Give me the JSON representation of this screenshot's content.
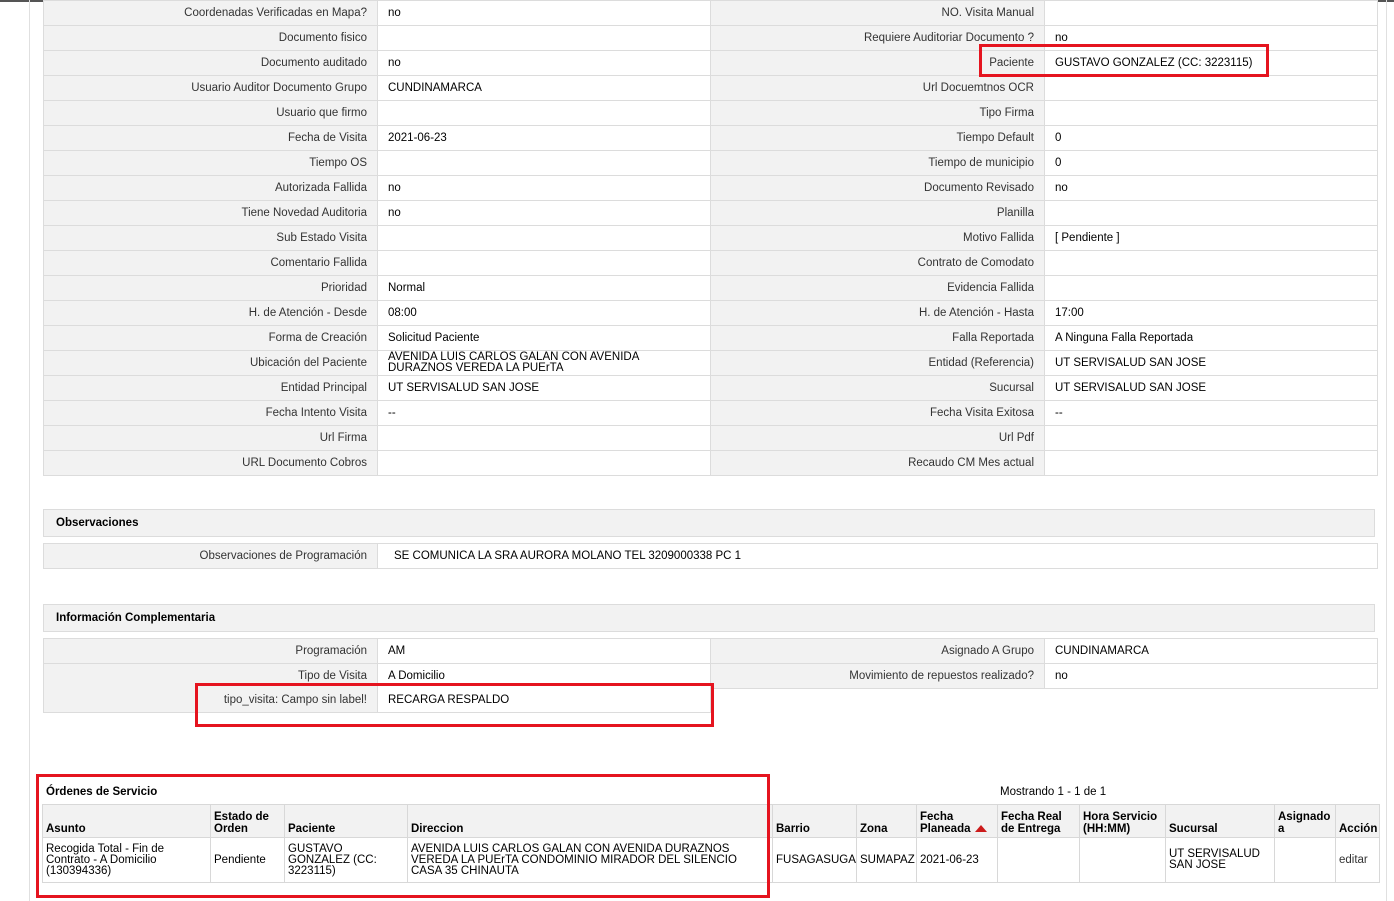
{
  "details": [
    {
      "l1": "Coordenadas Verificadas en Mapa?",
      "v1": "no",
      "l2": "NO. Visita Manual",
      "v2": ""
    },
    {
      "l1": "Documento fisico",
      "v1": "",
      "l2": "Requiere Auditoriar Documento ?",
      "v2": "no"
    },
    {
      "l1": "Documento auditado",
      "v1": "no",
      "l2": "Paciente",
      "v2": "GUSTAVO GONZALEZ (CC: 3223115)"
    },
    {
      "l1": "Usuario Auditor Documento Grupo",
      "v1": "CUNDINAMARCA",
      "l2": "Url Docuemtnos OCR",
      "v2": ""
    },
    {
      "l1": "Usuario que firmo",
      "v1": "",
      "l2": "Tipo Firma",
      "v2": ""
    },
    {
      "l1": "Fecha de Visita",
      "v1": "2021-06-23",
      "l2": "Tiempo Default",
      "v2": "0"
    },
    {
      "l1": "Tiempo OS",
      "v1": "",
      "l2": "Tiempo de municipio",
      "v2": "0"
    },
    {
      "l1": "Autorizada Fallida",
      "v1": "no",
      "l2": "Documento Revisado",
      "v2": "no"
    },
    {
      "l1": "Tiene Novedad Auditoria",
      "v1": "no",
      "l2": "Planilla",
      "v2": ""
    },
    {
      "l1": "Sub Estado Visita",
      "v1": "",
      "l2": "Motivo Fallida",
      "v2": "[ Pendiente ]"
    },
    {
      "l1": "Comentario Fallida",
      "v1": "",
      "l2": "Contrato de Comodato",
      "v2": ""
    },
    {
      "l1": "Prioridad",
      "v1": "Normal",
      "l2": "Evidencia Fallida",
      "v2": ""
    },
    {
      "l1": "H. de Atención - Desde",
      "v1": "08:00",
      "l2": "H. de Atención - Hasta",
      "v2": "17:00"
    },
    {
      "l1": "Forma de Creación",
      "v1": "Solicitud Paciente",
      "l2": "Falla Reportada",
      "v2": "A Ninguna Falla Reportada"
    },
    {
      "l1": "Ubicación del Paciente",
      "v1": "AVENIDA LUIS CARLOS GALAN CON AVENIDA DURAZNOS VEREDA LA PUErTA",
      "l2": "Entidad (Referencia)",
      "v2": "UT SERVISALUD SAN JOSE"
    },
    {
      "l1": "Entidad Principal",
      "v1": "UT SERVISALUD SAN JOSE",
      "l2": "Sucursal",
      "v2": "UT SERVISALUD SAN JOSE"
    },
    {
      "l1": "Fecha Intento Visita",
      "v1": "--",
      "l2": "Fecha Visita Exitosa",
      "v2": "--"
    },
    {
      "l1": "Url Firma",
      "v1": "",
      "l2": "Url Pdf",
      "v2": ""
    },
    {
      "l1": "URL Documento Cobros",
      "v1": "",
      "l2": "Recaudo CM Mes actual",
      "v2": ""
    }
  ],
  "observaciones": {
    "title": "Observaciones",
    "label": "Observaciones de Programación",
    "value": "SE COMUNICA LA SRA AURORA MOLANO TEL 3209000338 PC 1"
  },
  "complementaria": {
    "title": "Información Complementaria",
    "rows": [
      {
        "l1": "Programación",
        "v1": "AM",
        "l2": "Asignado A Grupo",
        "v2": "CUNDINAMARCA"
      },
      {
        "l1": "Tipo de Visita",
        "v1": "A Domicilio",
        "l2": "Movimiento de repuestos realizado?",
        "v2": "no"
      }
    ],
    "extra_label": "tipo_visita: Campo sin label!",
    "extra_value": "RECARGA RESPALDO"
  },
  "ordenes": {
    "title": "Órdenes de Servicio",
    "count": "Mostrando 1 - 1 de 1",
    "headers": [
      "Asunto",
      "Estado de Orden",
      "Paciente",
      "Direccion",
      "Barrio",
      "Zona",
      "Fecha Planeada",
      "Fecha Real de Entrega",
      "Hora Servicio (HH:MM)",
      "Sucursal",
      "Asignado a",
      "Acción"
    ],
    "rows": [
      [
        "Recogida Total - Fin de Contrato - A Domicilio (130394336)",
        "Pendiente",
        "GUSTAVO GONZALEZ (CC: 3223115)",
        "AVENIDA LUIS CARLOS GALAN CON AVENIDA DURAZNOS VEREDA LA PUErTA CONDOMINIO MIRADOR DEL SILENCIO CASA 35 CHINAUTA",
        "FUSAGASUGA",
        "SUMAPAZ",
        "2021-06-23",
        "",
        "",
        "UT SERVISALUD SAN JOSE",
        "",
        "editar"
      ]
    ]
  },
  "colors": {
    "highlight": "#e5141f",
    "header_bg": "#f2f2f2",
    "sort_arrow": "#cc1b1b"
  }
}
